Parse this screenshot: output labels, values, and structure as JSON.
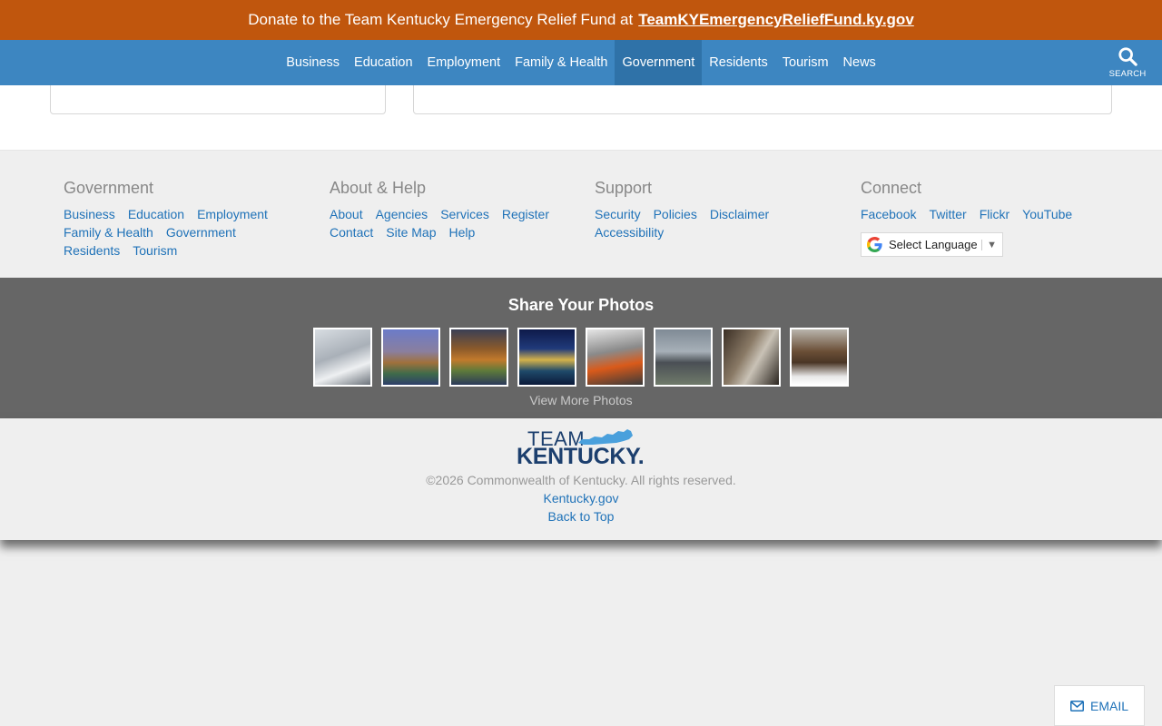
{
  "banner": {
    "lead": "Donate to the Team Kentucky Emergency Relief Fund at",
    "link": "TeamKYEmergencyReliefFund.ky.gov",
    "color": "#c0560d"
  },
  "nav": {
    "color": "#3d86c1",
    "items": [
      "Business",
      "Education",
      "Employment",
      "Family & Health",
      "Government",
      "Residents",
      "Tourism",
      "News"
    ],
    "active": "Government",
    "search_label": "SEARCH"
  },
  "footer": {
    "columns": [
      {
        "title": "Government",
        "links": [
          "Business",
          "Education",
          "Employment",
          "Family & Health",
          "Government",
          "Residents",
          "Tourism"
        ]
      },
      {
        "title": "About & Help",
        "links": [
          "About",
          "Agencies",
          "Services",
          "Register",
          "Contact",
          "Site Map",
          "Help"
        ]
      },
      {
        "title": "Support",
        "links": [
          "Security",
          "Policies",
          "Disclaimer",
          "Accessibility"
        ]
      },
      {
        "title": "Connect",
        "links": [
          "Facebook",
          "Twitter",
          "Flickr",
          "YouTube"
        ]
      }
    ],
    "language_select": "Select Language",
    "language_arrow": "▼"
  },
  "photos": {
    "title": "Share Your Photos",
    "view_more": "View More Photos",
    "count": 8
  },
  "bottom": {
    "logo_top": "TEAM",
    "logo_bottom": "KENTUCKY.",
    "copyright": "©2026 Commonwealth of Kentucky. All rights reserved.",
    "site_link": "Kentucky.gov",
    "back_to_top": "Back to Top"
  },
  "email_button": "EMAIL"
}
